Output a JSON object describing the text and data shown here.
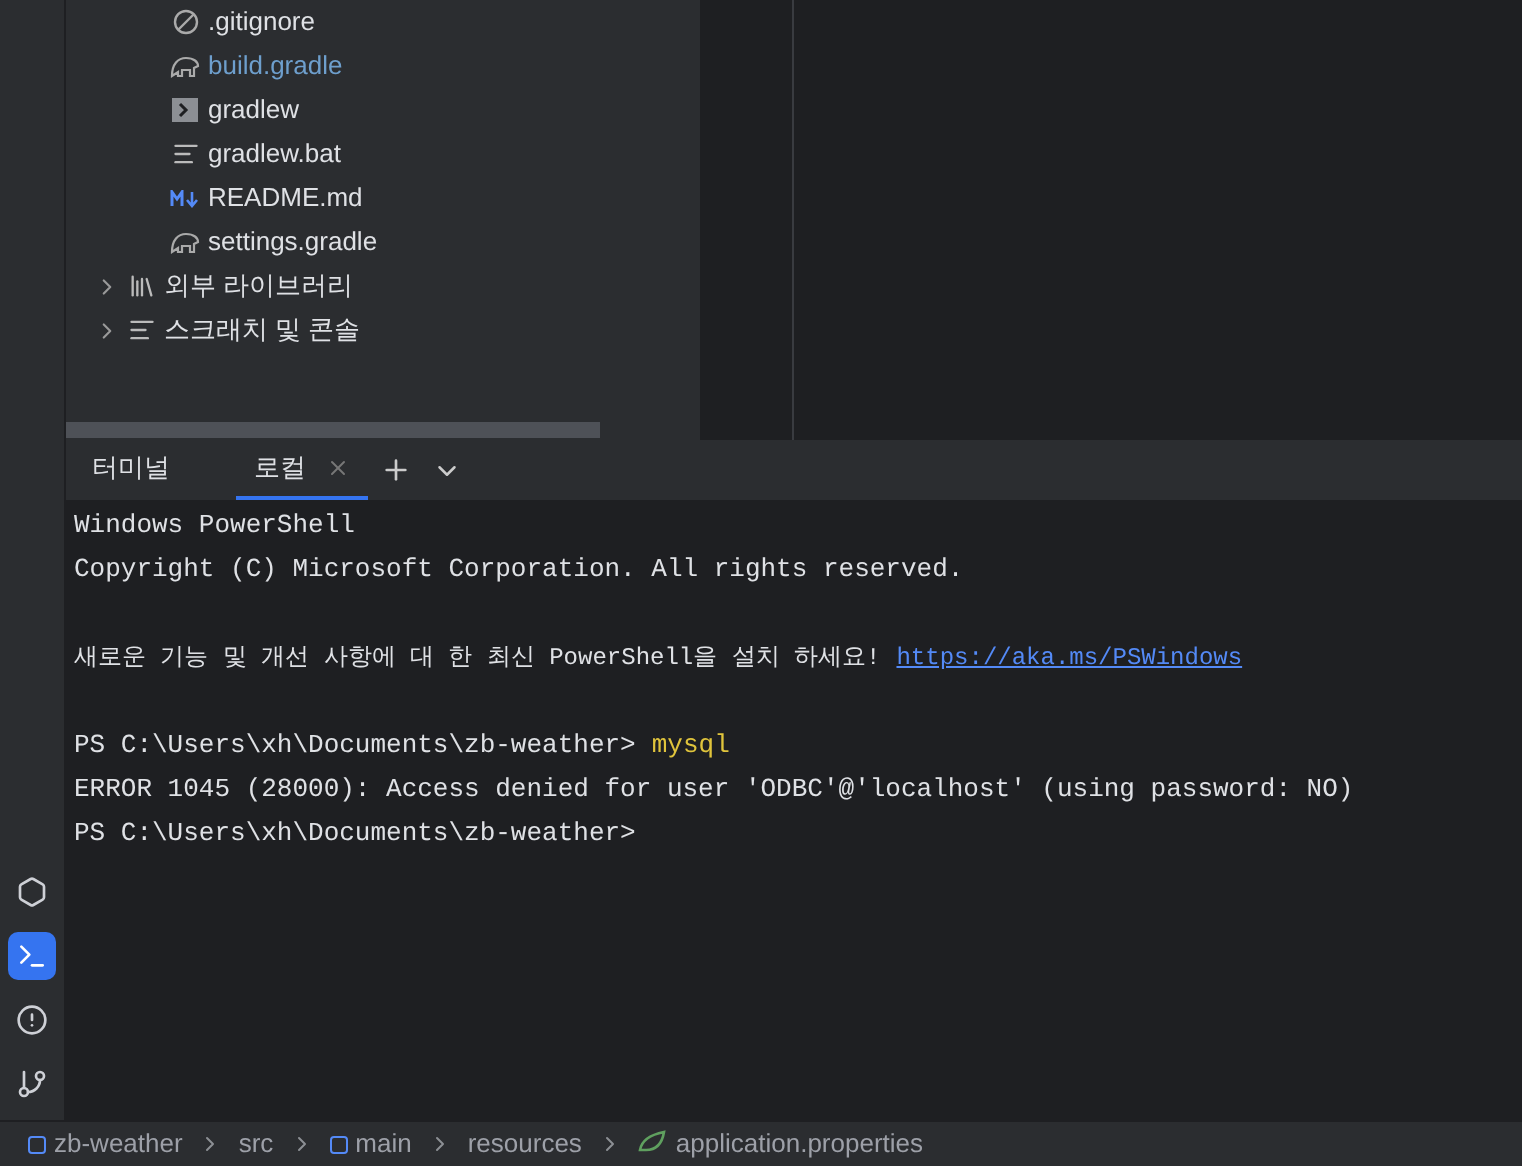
{
  "project_tree": {
    "files": [
      {
        "name": ".gitignore",
        "kind": "ignore",
        "color": "#dfe1e5"
      },
      {
        "name": "build.gradle",
        "kind": "gradle",
        "color": "#6e9fcd"
      },
      {
        "name": "gradlew",
        "kind": "shell",
        "color": "#dfe1e5"
      },
      {
        "name": "gradlew.bat",
        "kind": "text",
        "color": "#dfe1e5"
      },
      {
        "name": "README.md",
        "kind": "markdown",
        "color": "#dfe1e5"
      },
      {
        "name": "settings.gradle",
        "kind": "gradle",
        "color": "#dfe1e5"
      }
    ],
    "groups": [
      {
        "name": "외부 라이브러리",
        "kind": "libraries",
        "expanded": false
      },
      {
        "name": "스크래치 및 콘솔",
        "kind": "scratches",
        "expanded": false
      }
    ]
  },
  "tool_windows": [
    {
      "kind": "services",
      "selected": false
    },
    {
      "kind": "terminal",
      "selected": true
    },
    {
      "kind": "problems",
      "selected": false
    },
    {
      "kind": "git",
      "selected": false
    }
  ],
  "terminal": {
    "tabs": [
      {
        "label": "터미널",
        "selected": false,
        "closable": false
      },
      {
        "label": "로컬",
        "selected": true,
        "closable": true
      }
    ],
    "lines": [
      {
        "kind": "text",
        "text": "Windows PowerShell"
      },
      {
        "kind": "text",
        "text": "Copyright (C) Microsoft Corporation. All rights reserved."
      },
      {
        "kind": "blank"
      },
      {
        "kind": "notice",
        "text": "새로운 기능 및 개선 사항에 대 한 최신 PowerShell을 설치 하세요!",
        "link": "https://aka.ms/PSWindows"
      },
      {
        "kind": "blank"
      },
      {
        "kind": "prompt",
        "prompt": "PS C:\\Users\\xh\\Documents\\zb-weather>",
        "command": "mysql"
      },
      {
        "kind": "text",
        "text": "ERROR 1045 (28000): Access denied for user 'ODBC'@'localhost' (using password: NO)"
      },
      {
        "kind": "prompt",
        "prompt": "PS C:\\Users\\xh\\Documents\\zb-weather>"
      }
    ]
  },
  "breadcrumbs": [
    {
      "label": "zb-weather",
      "kind": "module"
    },
    {
      "label": "src",
      "kind": "folder"
    },
    {
      "label": "main",
      "kind": "module"
    },
    {
      "label": "resources",
      "kind": "folder"
    },
    {
      "label": "application.properties",
      "kind": "spring"
    }
  ]
}
